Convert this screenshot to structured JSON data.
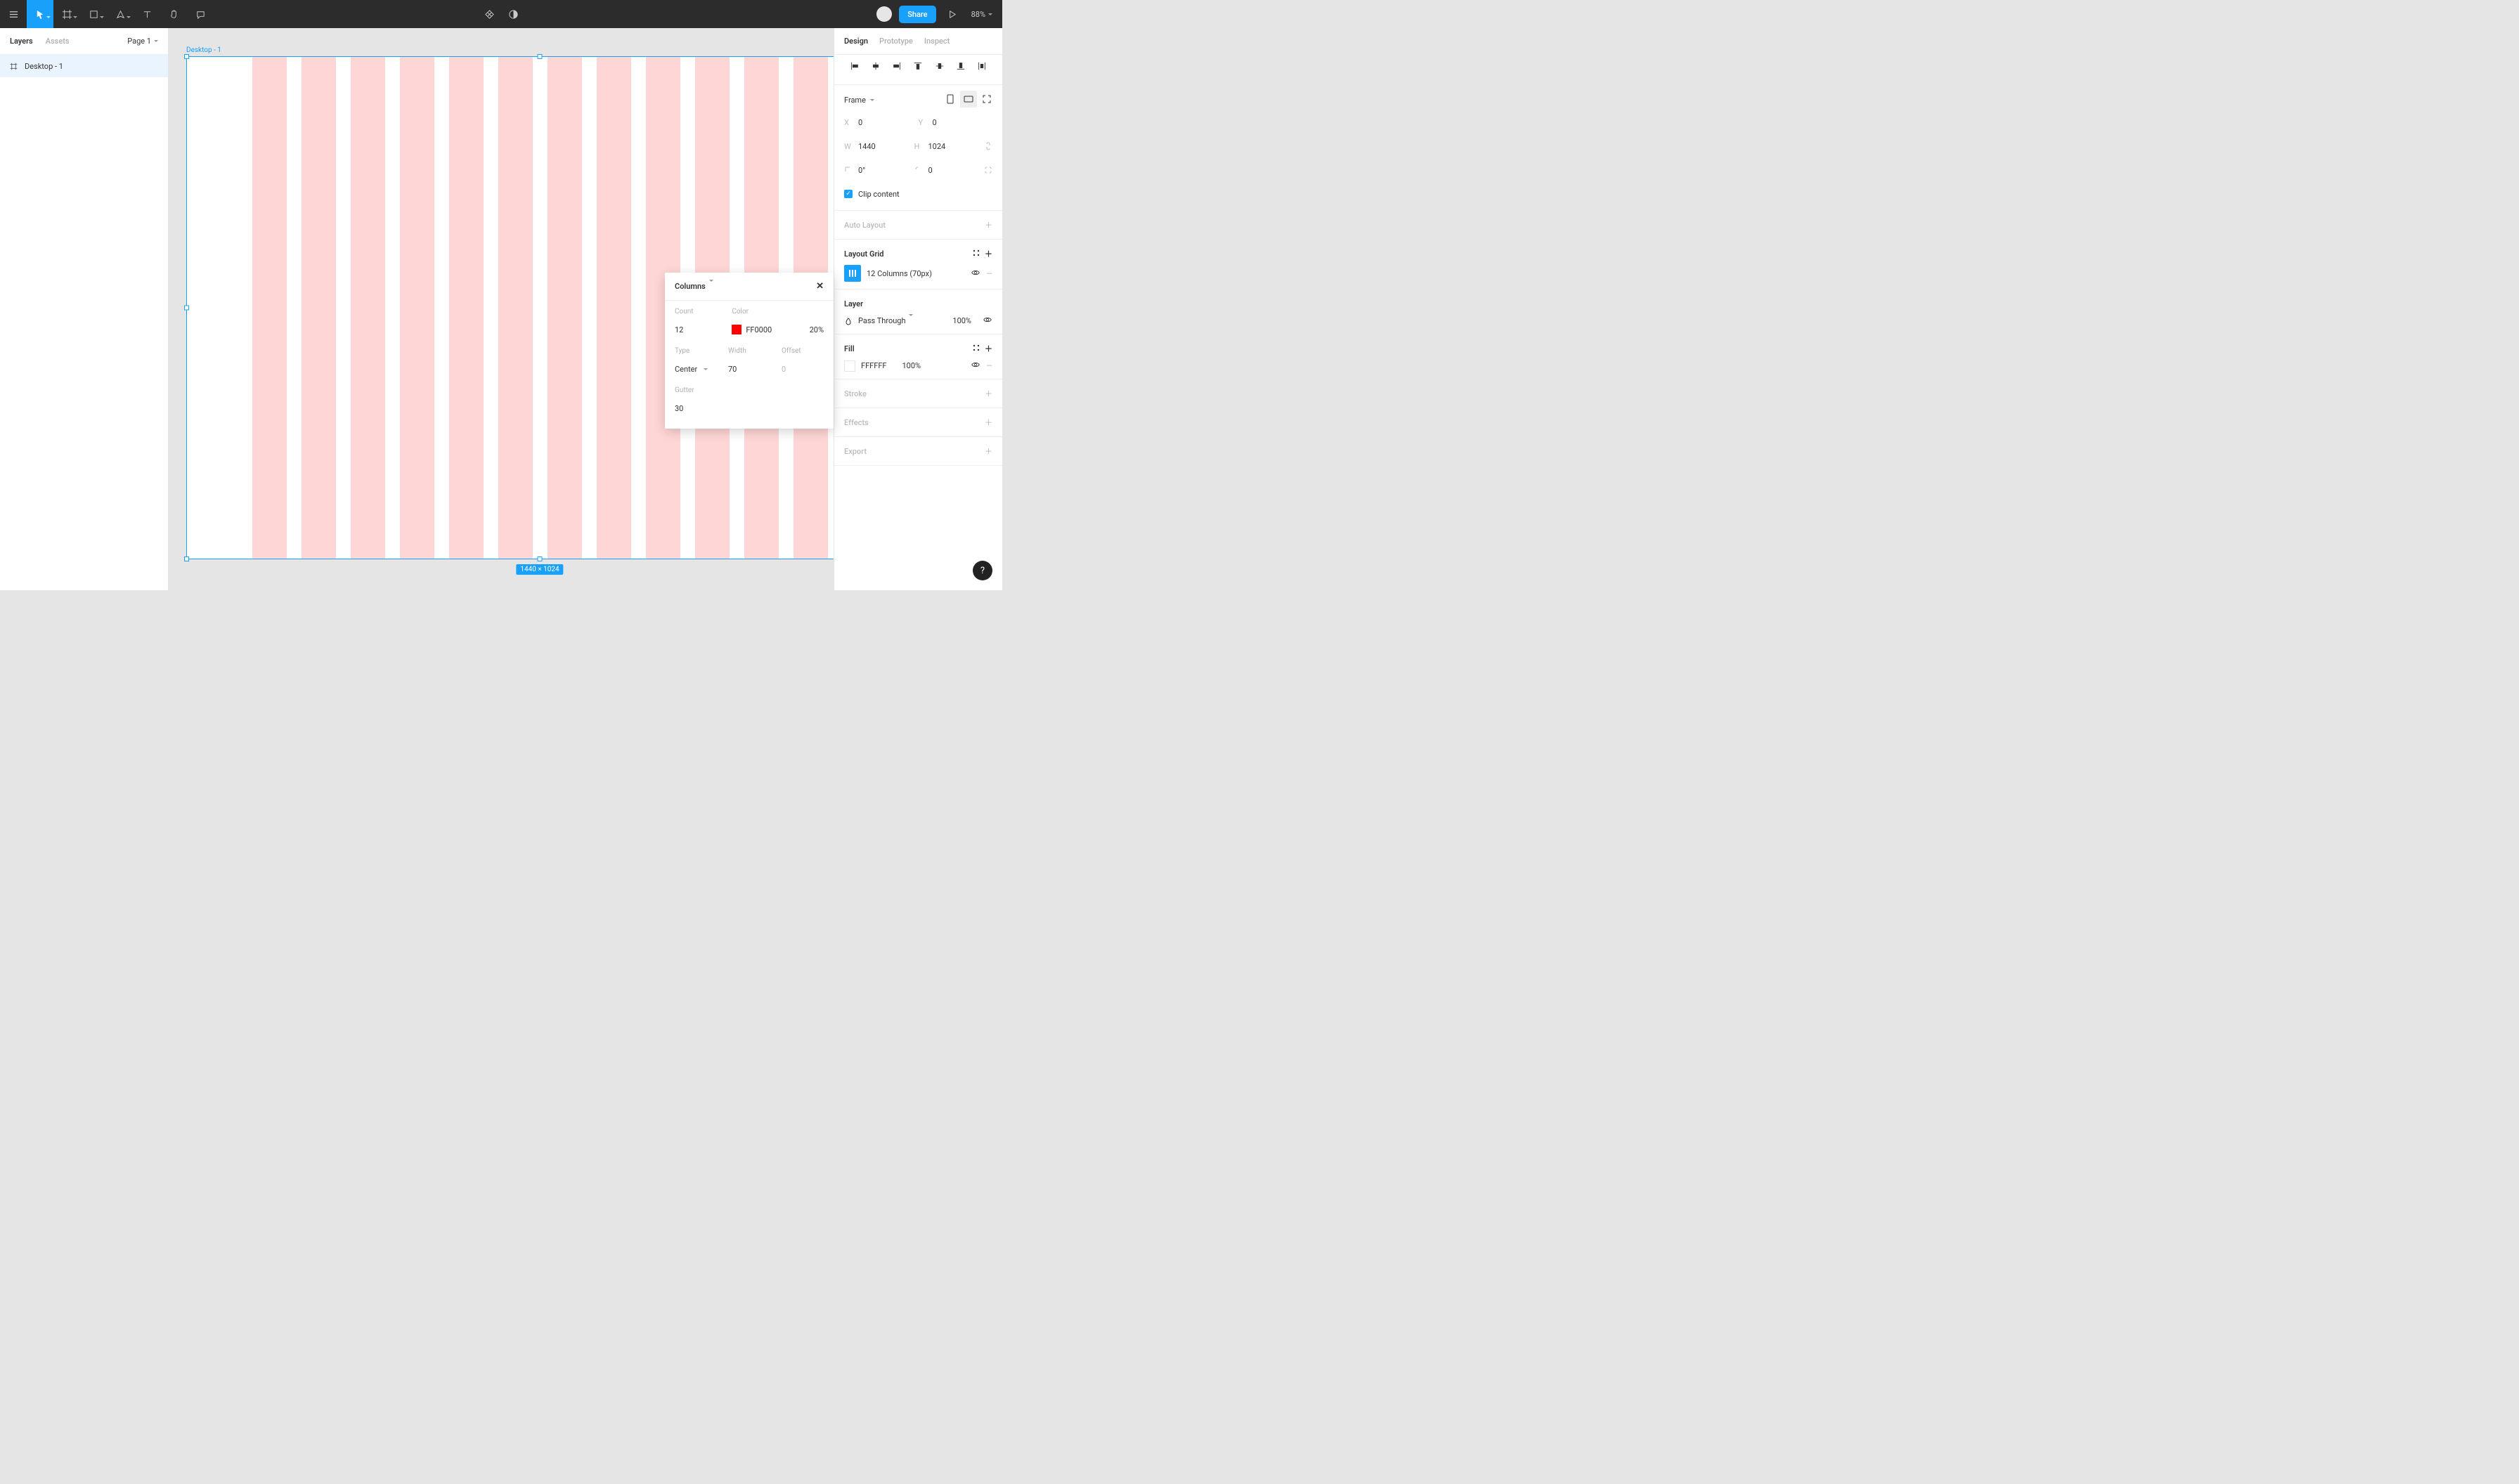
{
  "toolbar": {
    "share_label": "Share",
    "zoom_label": "88%"
  },
  "left_panel": {
    "tabs": {
      "layers": "Layers",
      "assets": "Assets"
    },
    "page_label": "Page 1",
    "layer_name": "Desktop - 1"
  },
  "canvas": {
    "frame_label": "Desktop - 1",
    "dims_label": "1440 × 1024"
  },
  "popover": {
    "title": "Columns",
    "count_label": "Count",
    "count_value": "12",
    "color_label": "Color",
    "color_hex": "FF0000",
    "color_alpha": "20%",
    "type_label": "Type",
    "type_value": "Center",
    "width_label": "Width",
    "width_value": "70",
    "offset_label": "Offset",
    "offset_value": "0",
    "gutter_label": "Gutter",
    "gutter_value": "30"
  },
  "right_panel": {
    "tabs": {
      "design": "Design",
      "prototype": "Prototype",
      "inspect": "Inspect"
    },
    "frame_dd": "Frame",
    "x": "0",
    "y": "0",
    "w": "1440",
    "h": "1024",
    "rot": "0°",
    "radius": "0",
    "clip_label": "Clip content",
    "auto_layout": "Auto Layout",
    "layout_grid": "Layout Grid",
    "grid_desc": "12 Columns (70px)",
    "layer_header": "Layer",
    "blend_mode": "Pass Through",
    "blend_opacity": "100%",
    "fill_header": "Fill",
    "fill_hex": "FFFFFF",
    "fill_opacity": "100%",
    "stroke": "Stroke",
    "effects": "Effects",
    "export": "Export"
  },
  "help_label": "?"
}
